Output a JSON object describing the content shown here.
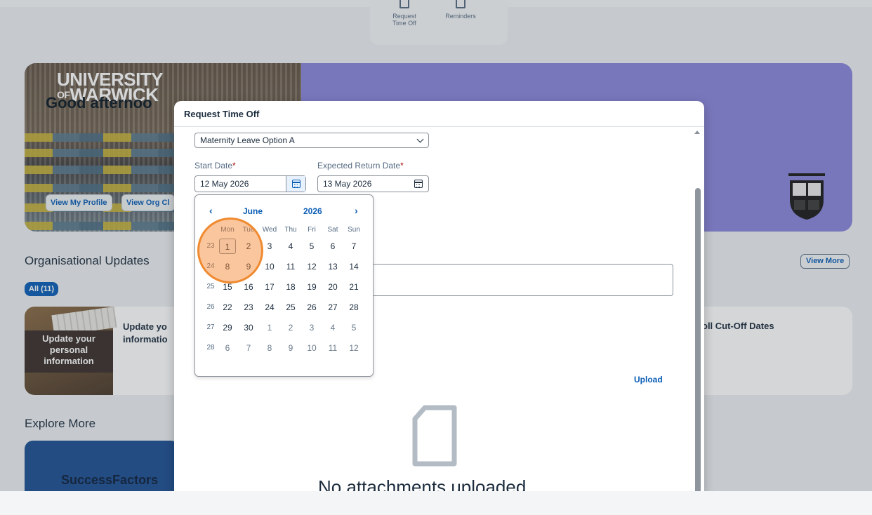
{
  "quick_actions": [
    {
      "label_line1": "Request",
      "label_line2": "Time Off",
      "icon": "calendar-plus-icon"
    },
    {
      "label_line1": "Reminders",
      "label_line2": "",
      "icon": "reminders-icon"
    }
  ],
  "banner": {
    "logo_line1": "UNIVERSITY",
    "logo_of": "OF",
    "logo_line2": "WARWICK",
    "greeting": "Good afternoo",
    "buttons": [
      "View My Profile",
      "View Org Cl"
    ],
    "accent_color": "#8b86dc"
  },
  "org_updates": {
    "title": "Organisational Updates",
    "filter_chip": "All (11)",
    "view_more": "View More",
    "card1_caption": "Update your personal information",
    "card1_title": "Update yo informatio",
    "card2_title": "oll Cut-Off Dates"
  },
  "explore": {
    "title": "Explore More",
    "card1": "SuccessFactors"
  },
  "dialog": {
    "title": "Request Time Off",
    "leave_type": "Maternity Leave Option A",
    "start_date_label": "Start Date",
    "return_date_label": "Expected Return Date",
    "required_marker": "*",
    "start_date_value": "12 May 2026",
    "return_date_value": "13 May 2026",
    "upload_label": "Upload",
    "no_attachments": "No attachments uploaded"
  },
  "calendar": {
    "prev": "‹",
    "next": "›",
    "month": "June",
    "year": "2026",
    "days_of_week": [
      "Mon",
      "Tue",
      "Wed",
      "Thu",
      "Fri",
      "Sat",
      "Sun"
    ],
    "weeks": [
      {
        "week": "23",
        "days": [
          "1",
          "2",
          "3",
          "4",
          "5",
          "6",
          "7"
        ]
      },
      {
        "week": "24",
        "days": [
          "8",
          "9",
          "10",
          "11",
          "12",
          "13",
          "14"
        ]
      },
      {
        "week": "25",
        "days": [
          "15",
          "16",
          "17",
          "18",
          "19",
          "20",
          "21"
        ]
      },
      {
        "week": "26",
        "days": [
          "22",
          "23",
          "24",
          "25",
          "26",
          "27",
          "28"
        ]
      },
      {
        "week": "27",
        "days": [
          "29",
          "30",
          "1",
          "2",
          "3",
          "4",
          "5"
        ]
      },
      {
        "week": "28",
        "days": [
          "6",
          "7",
          "8",
          "9",
          "10",
          "11",
          "12"
        ]
      }
    ]
  },
  "colors": {
    "brand_blue": "#0a5db5",
    "highlight_orange": "#f08a30",
    "required_red": "#aa0808"
  }
}
